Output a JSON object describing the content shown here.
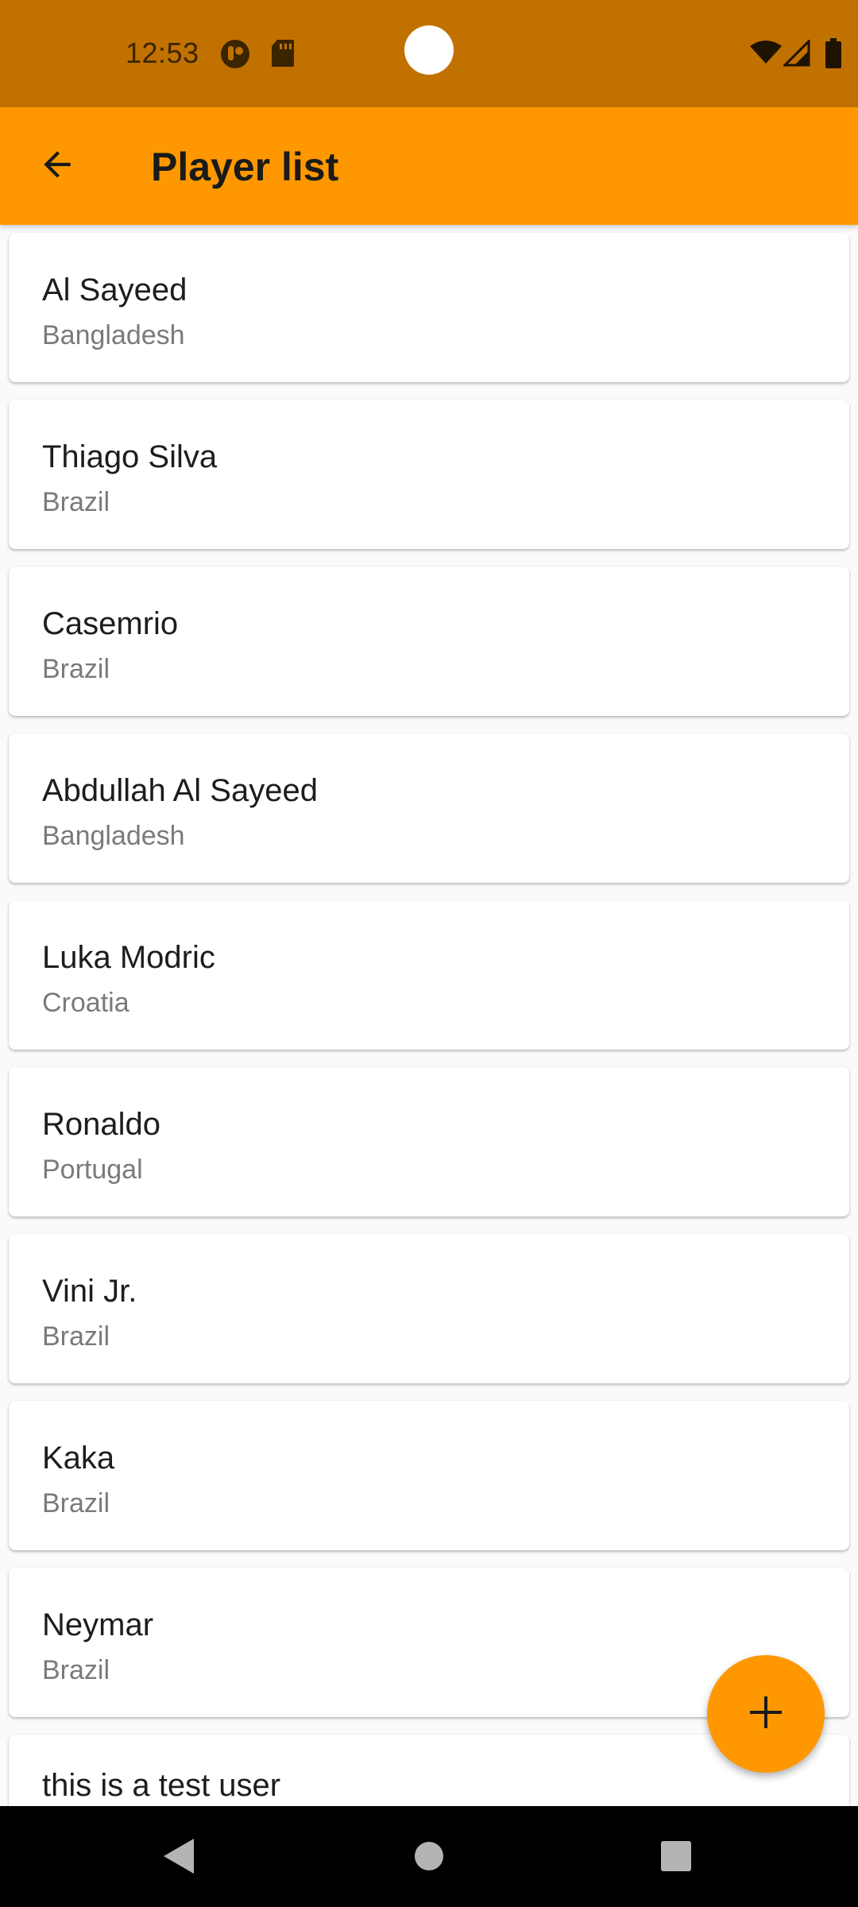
{
  "status_bar": {
    "time": "12:53",
    "icons": [
      "app-notification-icon",
      "sd-card-icon",
      "wifi-icon",
      "signal-icon",
      "battery-icon"
    ]
  },
  "app_bar": {
    "title": "Player list",
    "back_icon": "arrow-back-icon",
    "color": "#ff9800"
  },
  "players": [
    {
      "name": "Al Sayeed",
      "country": "Bangladesh"
    },
    {
      "name": "Thiago Silva",
      "country": "Brazil"
    },
    {
      "name": "Casemrio",
      "country": "Brazil"
    },
    {
      "name": "Abdullah Al Sayeed",
      "country": "Bangladesh"
    },
    {
      "name": "Luka Modric",
      "country": "Croatia"
    },
    {
      "name": "Ronaldo",
      "country": "Portugal"
    },
    {
      "name": "Vini Jr.",
      "country": "Brazil"
    },
    {
      "name": "Kaka",
      "country": "Brazil"
    },
    {
      "name": "Neymar",
      "country": "Brazil"
    },
    {
      "name": "this is a test user",
      "country": ""
    }
  ],
  "fab": {
    "icon": "add-icon"
  },
  "nav_bar": {
    "buttons": [
      "back-nav-icon",
      "home-nav-icon",
      "recents-nav-icon"
    ]
  },
  "colors": {
    "status_bar": "#c17100",
    "accent": "#ff9800"
  }
}
